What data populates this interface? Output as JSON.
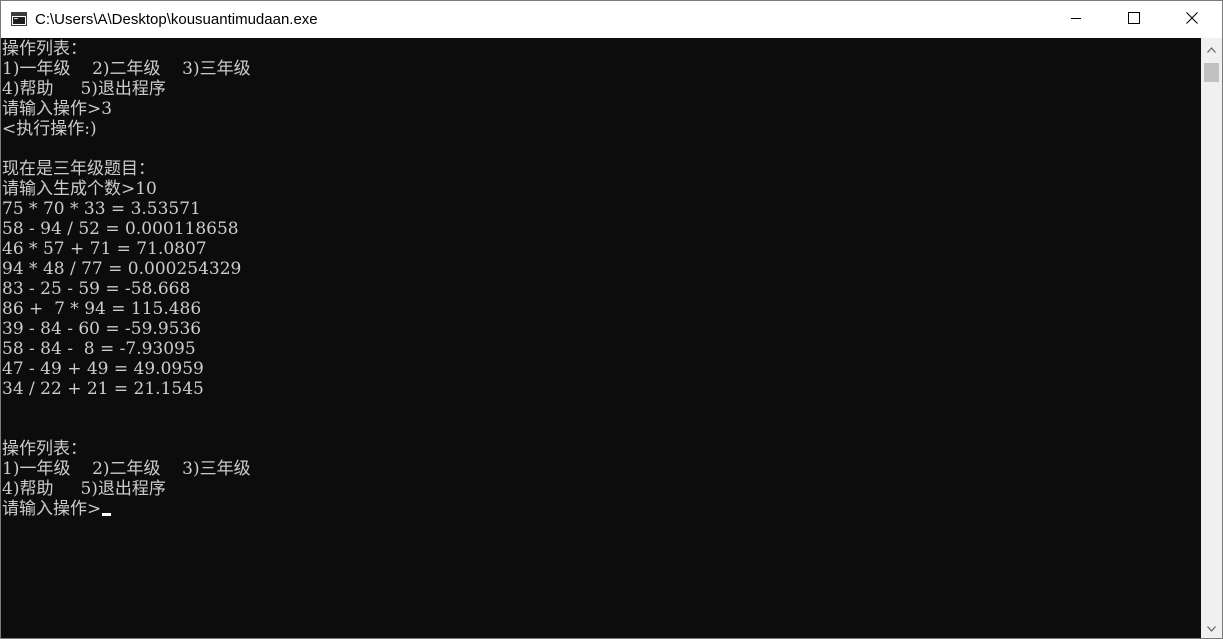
{
  "window": {
    "title": "C:\\Users\\A\\Desktop\\kousuantimudaan.exe"
  },
  "icons": {
    "app": "console-app-icon",
    "minimize": "minimize-icon",
    "maximize": "maximize-icon",
    "close": "close-icon",
    "scroll_up": "scroll-up-arrow-icon",
    "scroll_down": "scroll-down-arrow-icon"
  },
  "console": {
    "lines": [
      "操作列表：",
      "1)一年级    2)二年级    3)三年级",
      "4)帮助     5)退出程序",
      "请输入操作>3",
      "<执行操作:)",
      "",
      "现在是三年级题目：",
      "请输入生成个数>10",
      "75 * 70 * 33 = 3.53571",
      "58 - 94 / 52 = 0.000118658",
      "46 * 57 + 71 = 71.0807",
      "94 * 48 / 77 = 0.000254329",
      "83 - 25 - 59 = -58.668",
      "86 +  7 * 94 = 115.486",
      "39 - 84 - 60 = -59.9536",
      "58 - 84 -  8 = -7.93095",
      "47 - 49 + 49 = 49.0959",
      "34 / 22 + 21 = 21.1545",
      "",
      "",
      "操作列表：",
      "1)一年级    2)二年级    3)三年级",
      "4)帮助     5)退出程序"
    ],
    "prompt": "请输入操作>"
  },
  "colors": {
    "console_bg": "#0c0c0c",
    "console_text": "#cccccc",
    "titlebar_bg": "#ffffff",
    "scrollbar_bg": "#f0f0f0",
    "scrollbar_thumb": "#c1c1c1"
  }
}
